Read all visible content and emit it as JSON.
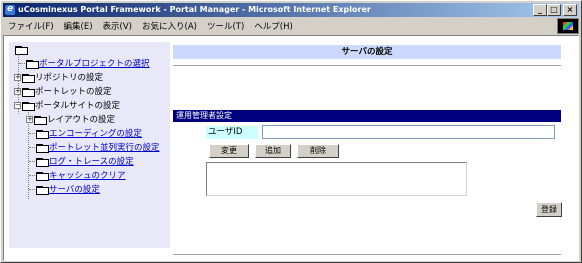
{
  "window": {
    "title": "uCosminexus Portal Framework - Portal Manager - Microsoft Internet Explorer",
    "controls": [
      "_",
      "□",
      "×"
    ]
  },
  "menu": [
    "ファイル(F)",
    "編集(E)",
    "表示(V)",
    "お気に入り(A)",
    "ツール(T)",
    "ヘルプ(H)"
  ],
  "tree": [
    {
      "label": "ボータルプロジェクトの選択",
      "link": true
    },
    {
      "label": "リポジトリの設定",
      "link": false
    },
    {
      "label": "ポートレットの設定",
      "link": false
    },
    {
      "label": "ポータルサイトの設定",
      "link": false
    },
    {
      "label": "レイアウトの設定",
      "link": false
    },
    {
      "label": "エンコーディングの設定",
      "link": true
    },
    {
      "label": "ポートレット並列実行の設定",
      "link": true
    },
    {
      "label": "ログ・トレースの設定",
      "link": true
    },
    {
      "label": "キャッシュのクリア",
      "link": true
    },
    {
      "label": "サーバの設定",
      "link": true
    }
  ],
  "main": {
    "section_title": "サーバの設定",
    "group_title": "運用管理者設定",
    "user_id_label": "ユーザID",
    "user_id_value": "",
    "change_button": "変更",
    "add_button": "追加",
    "delete_button": "削除",
    "user_list_value": "",
    "register_button": "登録"
  }
}
